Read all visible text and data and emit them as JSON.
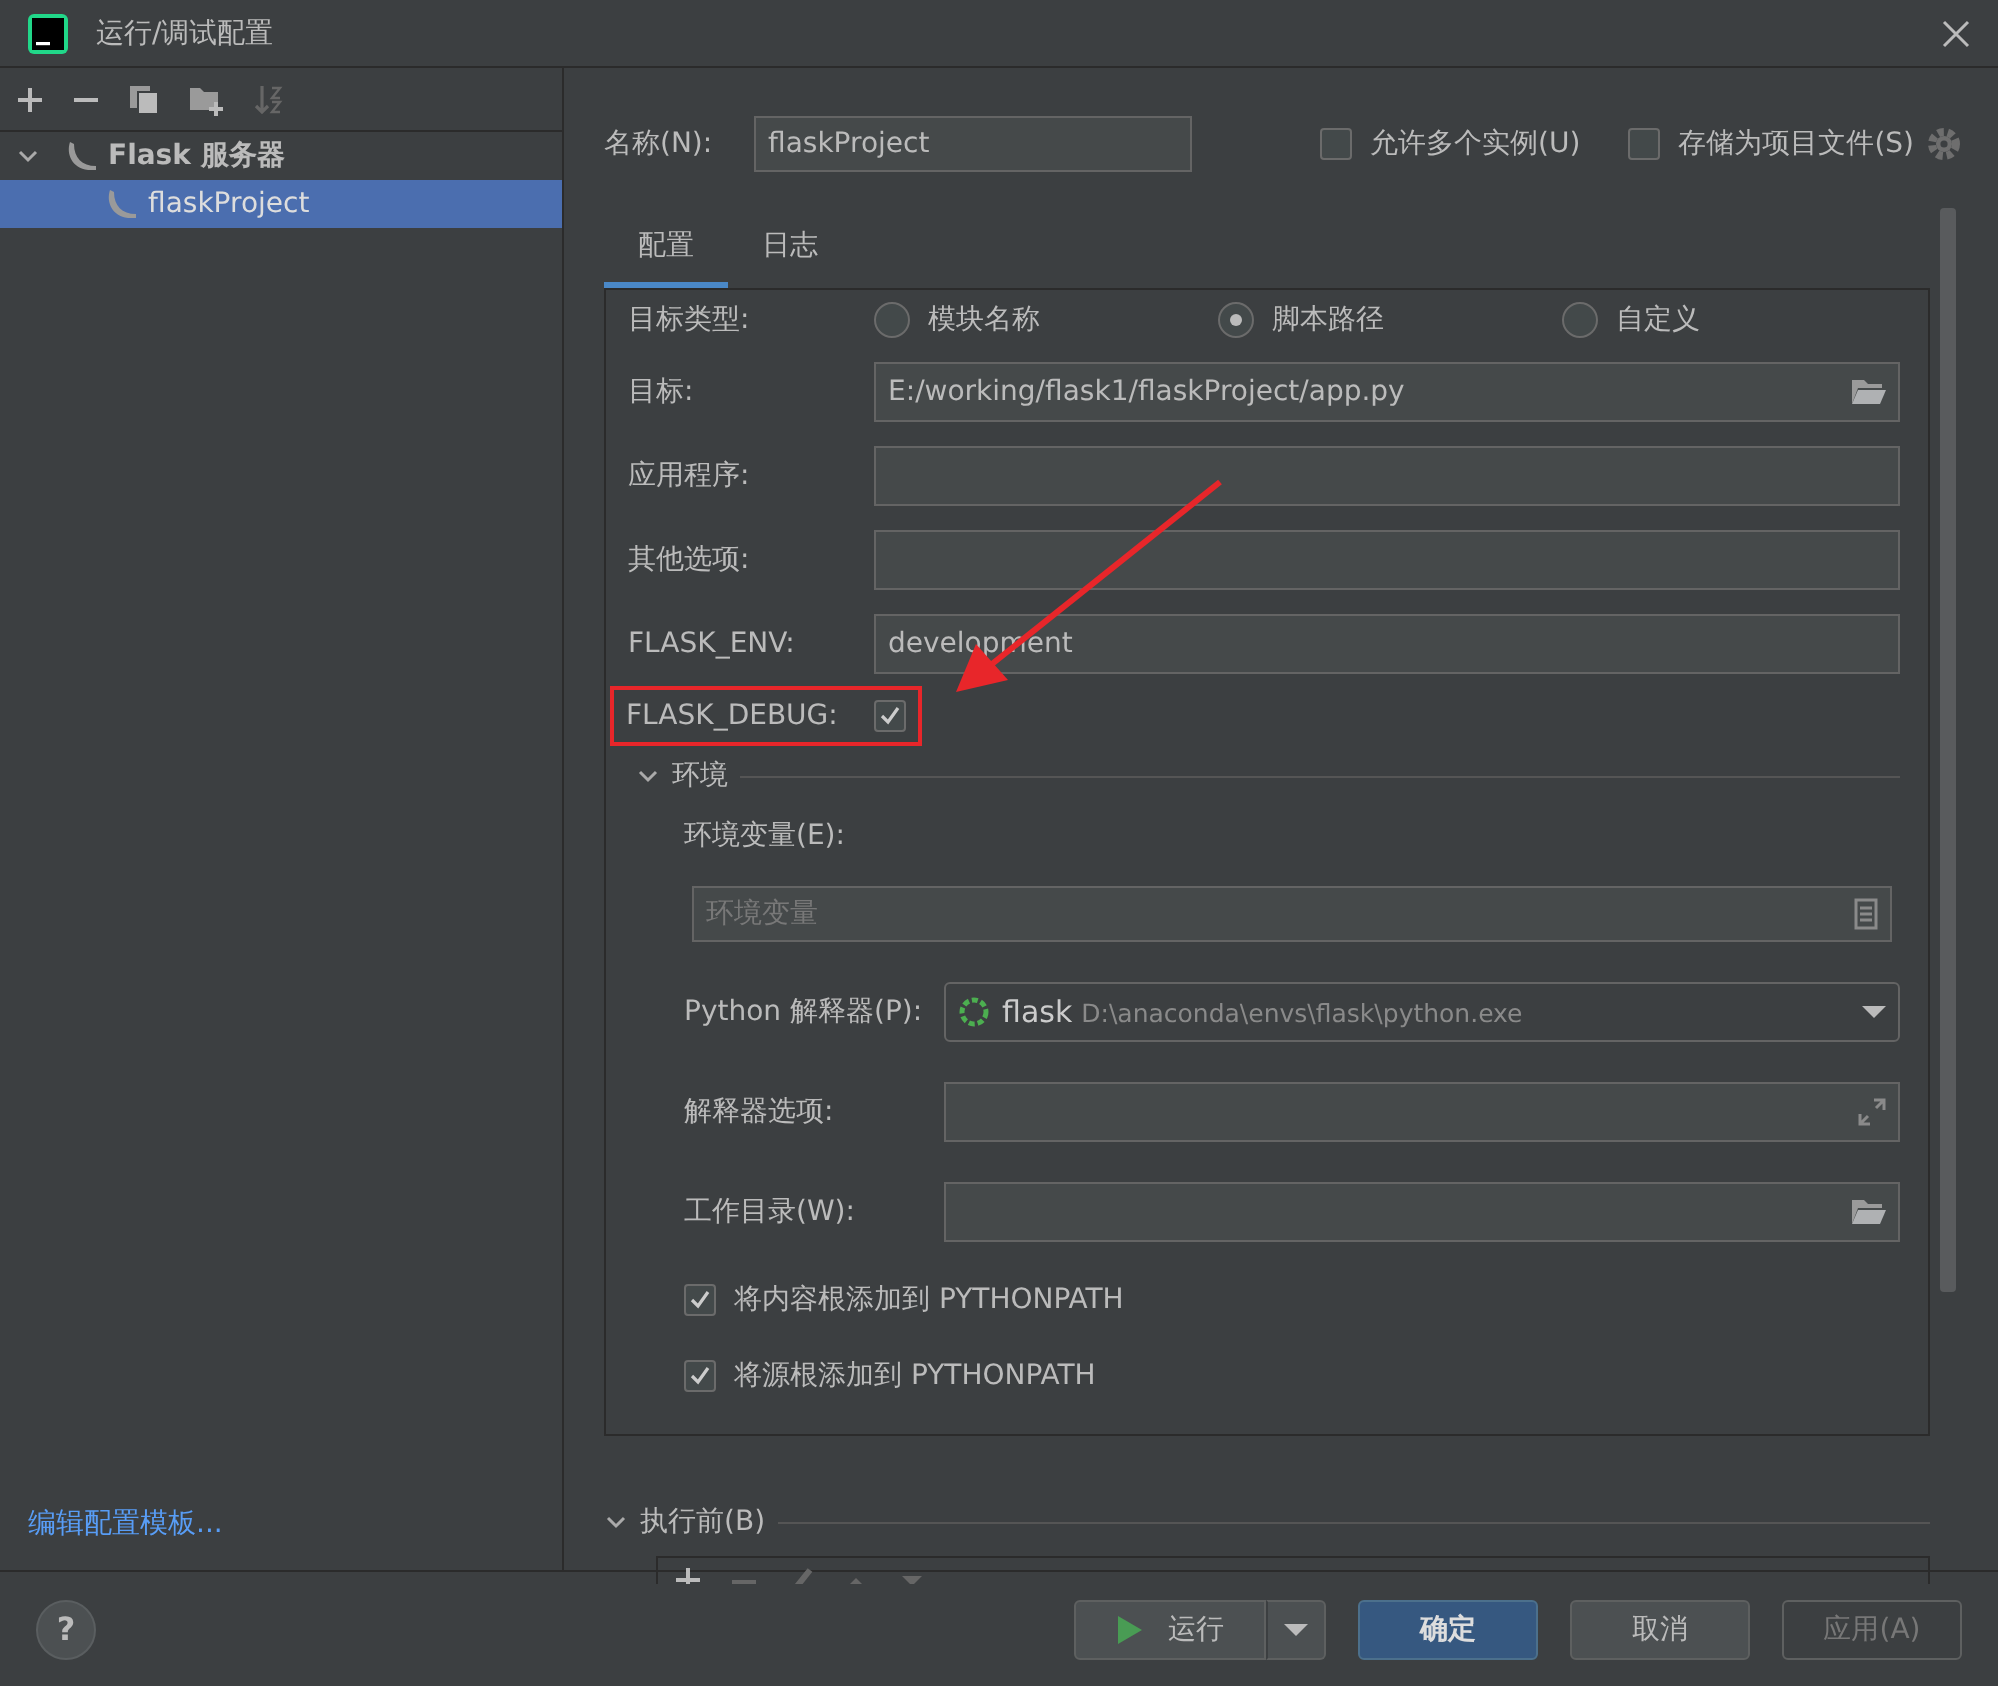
{
  "window": {
    "title": "运行/调试配置"
  },
  "tree": [
    {
      "label": "Flask 服务器",
      "expanded": true,
      "selected": false,
      "children": [
        {
          "label": "flaskProject",
          "selected": true
        }
      ]
    }
  ],
  "edit_templates_link": "编辑配置模板...",
  "name_field": {
    "label": "名称(N):",
    "value": "flaskProject"
  },
  "options": [
    {
      "label": "允许多个实例(U)",
      "checked": false
    },
    {
      "label": "存储为项目文件(S)",
      "checked": false
    }
  ],
  "tabs": [
    {
      "label": "配置",
      "selected": true
    },
    {
      "label": "日志",
      "selected": false
    }
  ],
  "target_type": {
    "label": "目标类型:",
    "options": [
      {
        "label": "模块名称",
        "selected": false
      },
      {
        "label": "脚本路径",
        "selected": true
      },
      {
        "label": "自定义",
        "selected": false
      }
    ]
  },
  "fields": [
    {
      "kind": "folder",
      "label": "目标:",
      "value": "E:/working/flask1/flaskProject/app.py"
    },
    {
      "kind": "plain",
      "label": "应用程序:"
    },
    {
      "kind": "plain",
      "label": "其他选项:"
    },
    {
      "kind": "plain",
      "label": "FLASK_ENV:",
      "value": "development"
    }
  ],
  "flask_debug": {
    "label": "FLASK_DEBUG:",
    "checked": true,
    "highlighted": true
  },
  "environment": {
    "label": "环境",
    "expanded": true,
    "env_vars": {
      "label": "环境变量(E):",
      "placeholder": "环境变量"
    },
    "interpreter": {
      "label": "Python 解释器(P):",
      "name": "flask",
      "path": "D:\\anaconda\\envs\\flask\\python.exe"
    },
    "fields": [
      {
        "kind": "expand",
        "label": "解释器选项:"
      },
      {
        "kind": "folder",
        "label": "工作目录(W):"
      }
    ],
    "checkboxes": [
      {
        "label": "将内容根添加到 PYTHONPATH",
        "checked": true
      },
      {
        "label": "将源根添加到 PYTHONPATH",
        "checked": true
      }
    ]
  },
  "before_launch": {
    "label": "执行前(B)",
    "expanded": true
  },
  "help_button": "?",
  "buttons": [
    {
      "kind": "run",
      "label": "运行",
      "disabled": false
    },
    {
      "kind": "primary",
      "label": "确定",
      "disabled": false
    },
    {
      "kind": "normal",
      "label": "取消",
      "disabled": false
    },
    {
      "kind": "normal",
      "label": "应用(A)",
      "disabled": true
    }
  ]
}
